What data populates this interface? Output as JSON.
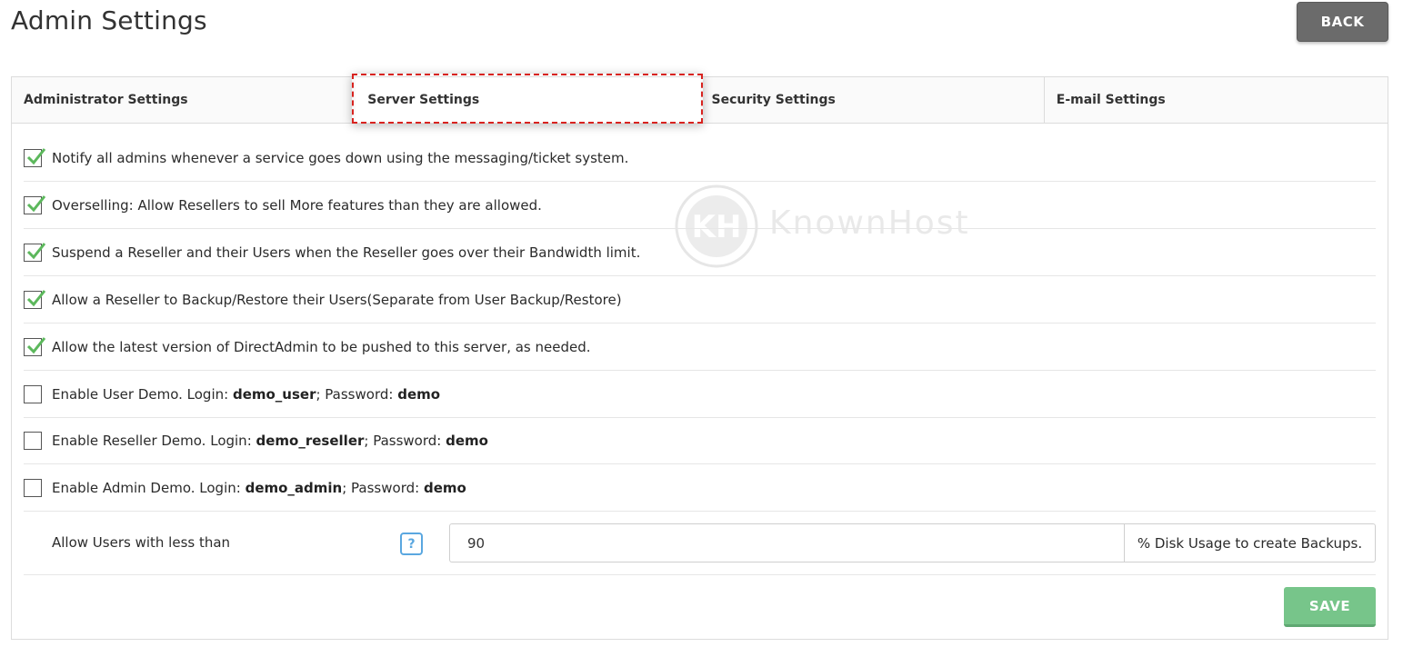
{
  "header": {
    "title": "Admin Settings",
    "back_label": "BACK"
  },
  "tabs": [
    {
      "label": "Administrator Settings"
    },
    {
      "label": "Server Settings"
    },
    {
      "label": "Security Settings"
    },
    {
      "label": "E-mail Settings"
    }
  ],
  "options": [
    {
      "checked": true,
      "text": "Notify all admins whenever a service goes down using the messaging/ticket system."
    },
    {
      "checked": true,
      "text": "Overselling: Allow Resellers to sell More features than they are allowed."
    },
    {
      "checked": true,
      "text": "Suspend a Reseller and their Users when the Reseller goes over their Bandwidth limit."
    },
    {
      "checked": true,
      "text": "Allow a Reseller to Backup/Restore their Users(Separate from User Backup/Restore)"
    },
    {
      "checked": true,
      "text": "Allow the latest version of DirectAdmin to be pushed to this server, as needed."
    }
  ],
  "demos": [
    {
      "checked": false,
      "prefix": "Enable User Demo. Login: ",
      "login": "demo_user",
      "mid": "; Password: ",
      "password": "demo"
    },
    {
      "checked": false,
      "prefix": "Enable Reseller Demo. Login: ",
      "login": "demo_reseller",
      "mid": "; Password: ",
      "password": "demo"
    },
    {
      "checked": false,
      "prefix": "Enable Admin Demo. Login: ",
      "login": "demo_admin",
      "mid": "; Password: ",
      "password": "demo"
    }
  ],
  "disk_usage": {
    "label": "Allow Users with less than",
    "help_label": "?",
    "value": "90",
    "suffix": "% Disk Usage to create Backups."
  },
  "save_label": "SAVE",
  "watermark": {
    "text": "KnownHost"
  },
  "colors": {
    "check": "#5cb85c",
    "highlight": "#d8231f",
    "save": "#77c58a",
    "help": "#5aa7e0"
  }
}
